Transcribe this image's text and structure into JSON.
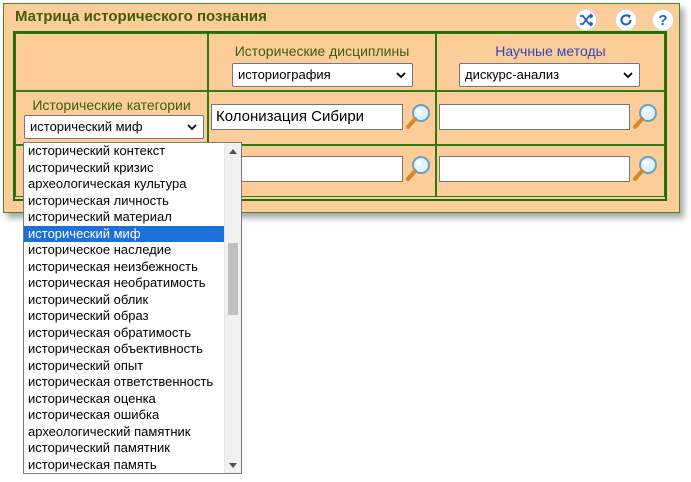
{
  "panel": {
    "title": "Матрица исторического познания",
    "background": "#fccc99",
    "border_color": "#3c8b26"
  },
  "toolbar": {
    "buttons": [
      {
        "icon": "shuffle-icon"
      },
      {
        "icon": "refresh-icon"
      },
      {
        "icon": "help-icon",
        "label": "?"
      }
    ]
  },
  "columns": {
    "disciplines": {
      "label": "Исторические дисциплины",
      "selected": "историография"
    },
    "methods": {
      "label": "Научные методы",
      "selected": "дискурс-анализ"
    }
  },
  "rows": {
    "categories": {
      "label": "Исторические категории",
      "selected": "исторический миф"
    }
  },
  "cells": {
    "r1c1": "Колонизация Сибири",
    "r1c2": "",
    "r2c1": "",
    "r2c2": ""
  },
  "dropdown": {
    "options": [
      "исторический контекст",
      "исторический кризис",
      "археологическая культура",
      "историческая личность",
      "исторический материал",
      "исторический миф",
      "историческое наследие",
      "историческая неизбежность",
      "историческая необратимость",
      "исторический облик",
      "исторический образ",
      "историческая обратимость",
      "историческая объективность",
      "исторический опыт",
      "историческая ответственность",
      "историческая оценка",
      "историческая ошибка",
      "археологический памятник",
      "исторический памятник",
      "историческая память"
    ],
    "selected_index": 5,
    "highlight_color": "#1e6fd9"
  }
}
